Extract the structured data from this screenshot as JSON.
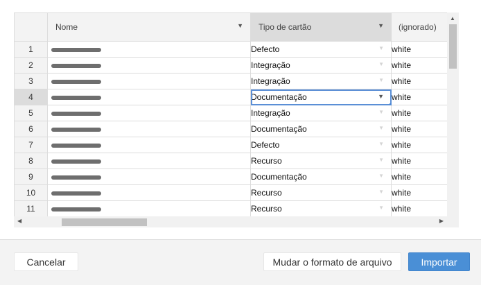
{
  "columns": {
    "name_header": "Nome",
    "type_header": "Tipo de cartão",
    "ignored_header": "(ignorado)"
  },
  "rows": [
    {
      "num": "1",
      "type": "Defecto",
      "color": "white"
    },
    {
      "num": "2",
      "type": "Integração",
      "color": "white"
    },
    {
      "num": "3",
      "type": "Integração",
      "color": "white"
    },
    {
      "num": "4",
      "type": "Documentação",
      "color": "white"
    },
    {
      "num": "5",
      "type": "Integração",
      "color": "white"
    },
    {
      "num": "6",
      "type": "Documentação",
      "color": "white"
    },
    {
      "num": "7",
      "type": "Defecto",
      "color": "white"
    },
    {
      "num": "8",
      "type": "Recurso",
      "color": "white"
    },
    {
      "num": "9",
      "type": "Documentação",
      "color": "white"
    },
    {
      "num": "10",
      "type": "Recurso",
      "color": "white"
    },
    {
      "num": "11",
      "type": "Recurso",
      "color": "white"
    }
  ],
  "selected_row": "4",
  "footer": {
    "cancel_label": "Cancelar",
    "format_label": "Mudar o formato de arquivo",
    "import_label": "Importar"
  },
  "colors": {
    "accent": "#4a8fd6",
    "selection_outline": "#5b8fd6",
    "header_bg": "#f3f3f3",
    "active_header_bg": "#dcdcdc"
  }
}
